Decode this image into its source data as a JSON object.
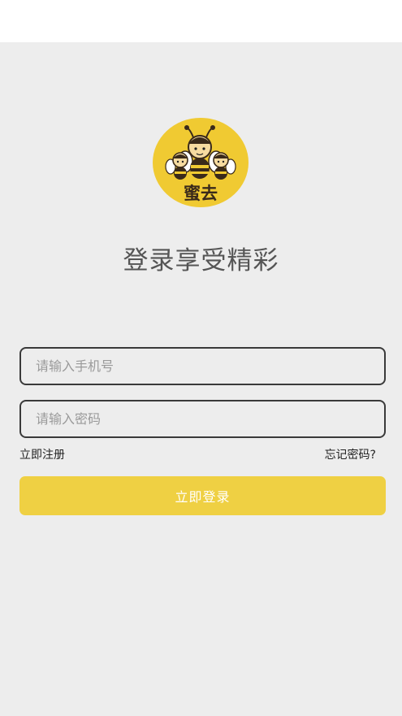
{
  "theme": {
    "background": "#ededed",
    "accent": "#efd043",
    "field_border": "#3a3a3a"
  },
  "logo": {
    "icon": "bee-mascot-logo",
    "text": "蜜去"
  },
  "headline": "登录享受精彩",
  "form": {
    "phone_placeholder": "请输入手机号",
    "password_placeholder": "请输入密码",
    "register_label": "立即注册",
    "forgot_label": "忘记密码?",
    "login_label": "立即登录"
  }
}
